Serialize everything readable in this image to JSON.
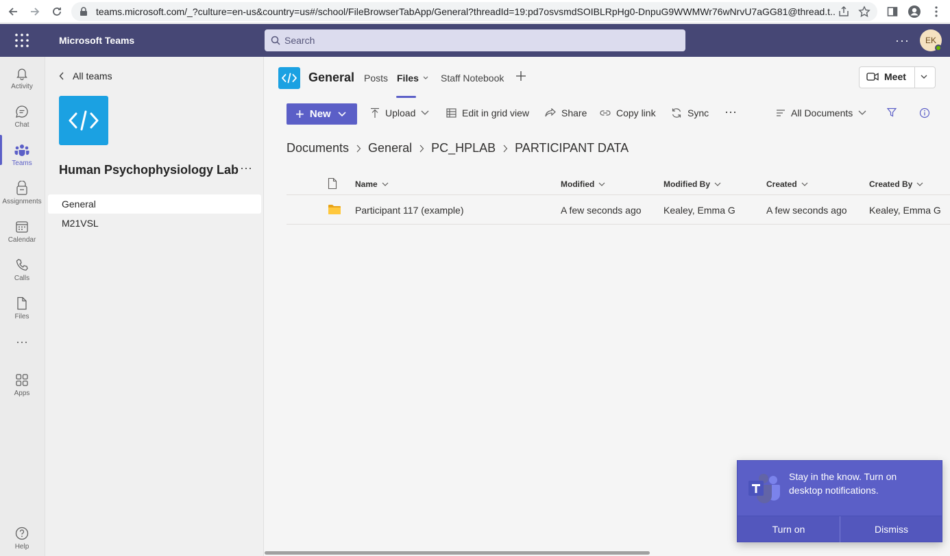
{
  "browser": {
    "url": "teams.microsoft.com/_?culture=en-us&country=us#/school/FileBrowserTabApp/General?threadId=19:pd7osvsmdSOIBLRpHg0-DnpuG9WWMWr76wNrvU7aGG81@thread.t..."
  },
  "header": {
    "app_title": "Microsoft Teams",
    "search_placeholder": "Search",
    "avatar_initials": "EK",
    "more_label": "···"
  },
  "rail": {
    "items": [
      {
        "label": "Activity",
        "icon": "bell-icon"
      },
      {
        "label": "Chat",
        "icon": "chat-icon"
      },
      {
        "label": "Teams",
        "icon": "teams-icon"
      },
      {
        "label": "Assignments",
        "icon": "assignments-icon"
      },
      {
        "label": "Calendar",
        "icon": "calendar-icon"
      },
      {
        "label": "Calls",
        "icon": "phone-icon"
      },
      {
        "label": "Files",
        "icon": "file-icon"
      },
      {
        "label": "Apps",
        "icon": "apps-icon"
      },
      {
        "label": "Help",
        "icon": "help-icon"
      }
    ],
    "more_label": "···"
  },
  "team_panel": {
    "back_label": "All teams",
    "team_name": "Human Psychophysiology Lab",
    "more_label": "···",
    "channels": [
      {
        "label": "General"
      },
      {
        "label": "M21VSL"
      }
    ]
  },
  "channel": {
    "title": "General",
    "tabs": [
      {
        "label": "Posts"
      },
      {
        "label": "Files"
      },
      {
        "label": "Staff Notebook"
      }
    ],
    "meet_label": "Meet"
  },
  "toolbar": {
    "new_label": "New",
    "upload_label": "Upload",
    "grid_label": "Edit in grid view",
    "share_label": "Share",
    "copy_link_label": "Copy link",
    "sync_label": "Sync",
    "more_label": "···",
    "view_label": "All Documents"
  },
  "breadcrumb": [
    "Documents",
    "General",
    "PC_HPLAB",
    "PARTICIPANT DATA"
  ],
  "file_table": {
    "columns": [
      "Name",
      "Modified",
      "Modified By",
      "Created",
      "Created By"
    ],
    "rows": [
      {
        "name": "Participant 117 (example)",
        "modified": "A few seconds ago",
        "modified_by": "Kealey, Emma G",
        "created": "A few seconds ago",
        "created_by": "Kealey, Emma G"
      }
    ]
  },
  "toast": {
    "message": "Stay in the know. Turn on desktop notifications.",
    "turn_on_label": "Turn on",
    "dismiss_label": "Dismiss"
  },
  "colors": {
    "brand": "#464775",
    "accent": "#5b5fc7",
    "team_logo": "#1ba1e2"
  }
}
